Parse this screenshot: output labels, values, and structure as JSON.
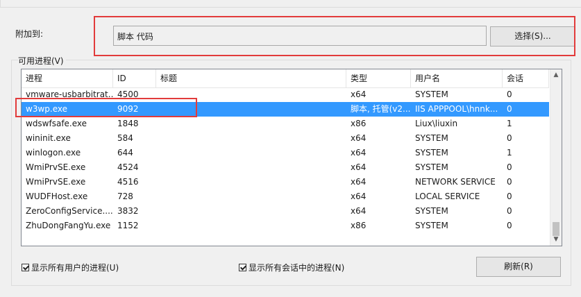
{
  "attach": {
    "label": "附加到:",
    "value": "脚本 代码",
    "select_button": "选择(S)..."
  },
  "processes": {
    "label": "可用进程(V)",
    "columns": [
      "进程",
      "ID",
      "标题",
      "类型",
      "用户名",
      "会话"
    ],
    "rows": [
      {
        "name": "vmware-usbarbitrat...",
        "id": "4500",
        "title": "",
        "type": "x64",
        "user": "SYSTEM",
        "session": "0"
      },
      {
        "name": "w3wp.exe",
        "id": "9092",
        "title": "",
        "type": "脚本, 托管(v2...",
        "user": "IIS APPPOOL\\hnnk...",
        "session": "0"
      },
      {
        "name": "wdswfsafe.exe",
        "id": "1848",
        "title": "",
        "type": "x86",
        "user": "Liux\\liuxin",
        "session": "1"
      },
      {
        "name": "wininit.exe",
        "id": "584",
        "title": "",
        "type": "x64",
        "user": "SYSTEM",
        "session": "0"
      },
      {
        "name": "winlogon.exe",
        "id": "644",
        "title": "",
        "type": "x64",
        "user": "SYSTEM",
        "session": "1"
      },
      {
        "name": "WmiPrvSE.exe",
        "id": "4524",
        "title": "",
        "type": "x64",
        "user": "SYSTEM",
        "session": "0"
      },
      {
        "name": "WmiPrvSE.exe",
        "id": "4516",
        "title": "",
        "type": "x64",
        "user": "NETWORK SERVICE",
        "session": "0"
      },
      {
        "name": "WUDFHost.exe",
        "id": "728",
        "title": "",
        "type": "x64",
        "user": "LOCAL SERVICE",
        "session": "0"
      },
      {
        "name": "ZeroConfigService....",
        "id": "3832",
        "title": "",
        "type": "x64",
        "user": "SYSTEM",
        "session": "0"
      },
      {
        "name": "ZhuDongFangYu.exe",
        "id": "1152",
        "title": "",
        "type": "x86",
        "user": "SYSTEM",
        "session": "0"
      }
    ],
    "selected_index": 1
  },
  "options": {
    "show_all_users": "显示所有用户的进程(U)",
    "show_all_sessions": "显示所有会话中的进程(N)",
    "refresh_button": "刷新(R)"
  },
  "colors": {
    "selection": "#3399ff",
    "highlight_box": "#e23b3b"
  },
  "icons": {
    "scroll_up": "chevron-up-icon",
    "scroll_down": "chevron-down-icon"
  }
}
